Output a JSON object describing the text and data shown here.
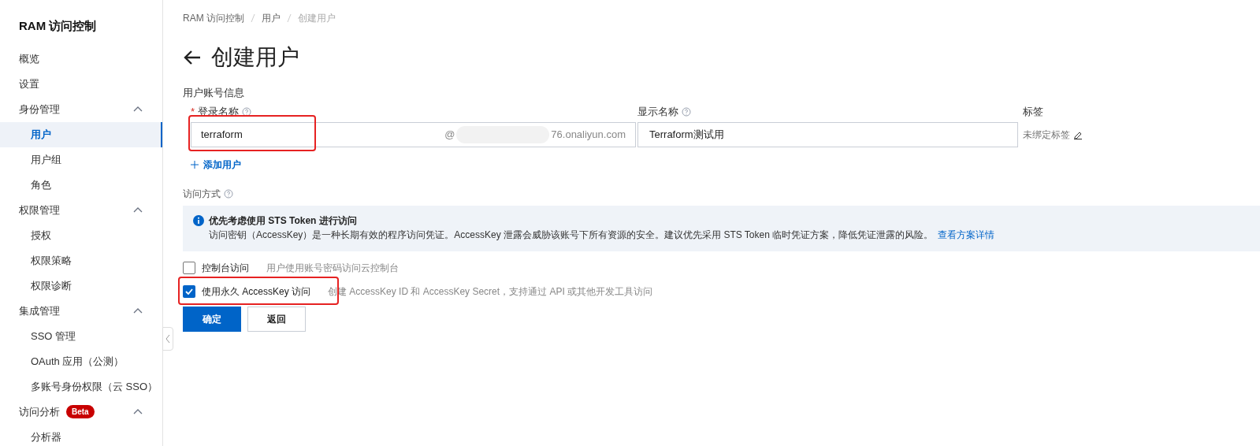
{
  "sidebar": {
    "title": "RAM 访问控制",
    "items": [
      {
        "label": "概览",
        "kind": "item",
        "selected": false
      },
      {
        "label": "设置",
        "kind": "item",
        "selected": false
      },
      {
        "label": "身份管理",
        "kind": "group",
        "expanded": true,
        "children": [
          {
            "label": "用户",
            "selected": true
          },
          {
            "label": "用户组",
            "selected": false
          },
          {
            "label": "角色",
            "selected": false
          }
        ]
      },
      {
        "label": "权限管理",
        "kind": "group",
        "expanded": true,
        "children": [
          {
            "label": "授权",
            "selected": false
          },
          {
            "label": "权限策略",
            "selected": false
          },
          {
            "label": "权限诊断",
            "selected": false
          }
        ]
      },
      {
        "label": "集成管理",
        "kind": "group",
        "expanded": true,
        "children": [
          {
            "label": "SSO 管理",
            "selected": false
          },
          {
            "label": "OAuth 应用（公测）",
            "selected": false
          },
          {
            "label": "多账号身份权限（云 SSO）",
            "selected": false
          }
        ]
      },
      {
        "label": "访问分析",
        "kind": "group",
        "badge": "Beta",
        "expanded": true,
        "children": [
          {
            "label": "分析器",
            "selected": false
          }
        ]
      }
    ]
  },
  "breadcrumb": [
    "RAM 访问控制",
    "用户",
    "创建用户"
  ],
  "page_title": "创建用户",
  "account_section": {
    "title": "用户账号信息",
    "login_name": {
      "label": "登录名称",
      "required_mark": "*",
      "value": "terraform",
      "suffix_at": "@",
      "suffix_domain": "76.onaliyun.com"
    },
    "display_name": {
      "label": "显示名称",
      "value": "Terraform测试用"
    },
    "tags": {
      "label": "标签",
      "value": "未绑定标签"
    },
    "add_user": "添加用户"
  },
  "access_section": {
    "title": "访问方式",
    "notice": {
      "title": "优先考虑使用 STS Token 进行访问",
      "text": "访问密钥（AccessKey）是一种长期有效的程序访问凭证。AccessKey 泄露会威胁该账号下所有资源的安全。建议优先采用 STS Token 临时凭证方案，降低凭证泄露的风险。",
      "link": "查看方案详情"
    },
    "options": [
      {
        "label": "控制台访问",
        "description": "用户使用账号密码访问云控制台",
        "checked": false
      },
      {
        "label": "使用永久 AccessKey 访问",
        "description": "创建 AccessKey ID 和 AccessKey Secret，支持通过 API 或其他开发工具访问",
        "checked": true
      }
    ]
  },
  "buttons": [
    {
      "label": "确定",
      "kind": "primary"
    },
    {
      "label": "返回",
      "kind": "secondary"
    }
  ]
}
